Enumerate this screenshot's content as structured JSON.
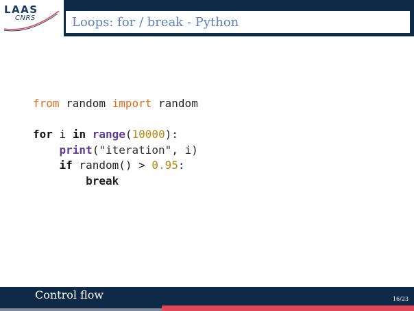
{
  "header": {
    "title": "Loops: for / break - Python",
    "logo": {
      "top": "LAAS",
      "bottom": "CNRS"
    }
  },
  "code": {
    "line1": {
      "kw_from": "from",
      "mod": " random ",
      "kw_import": "import",
      "name": " random"
    },
    "line3": {
      "kw_for": "for",
      "var": " i ",
      "kw_in": "in",
      "sp": " ",
      "fn": "range",
      "open": "(",
      "num": "10000",
      "close": "):"
    },
    "line4": {
      "indent": "    ",
      "fn": "print",
      "open": "(",
      "str": "\"iteration\"",
      "rest": ", i)"
    },
    "line5": {
      "indent": "    ",
      "kw_if": "if",
      "expr": " random() > ",
      "num": "0.95",
      "colon": ":"
    },
    "line6": {
      "indent": "        ",
      "kw_break": "break"
    }
  },
  "footer": {
    "section": "Control flow",
    "page": "16/23"
  },
  "colors": {
    "header_bg": "#0e2a47",
    "title": "#5b80bd",
    "accent_red": "#e0485a"
  }
}
